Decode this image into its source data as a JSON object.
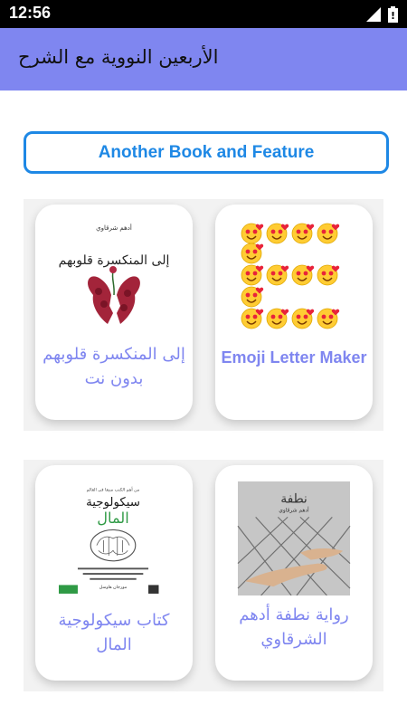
{
  "status_bar": {
    "time": "12:56"
  },
  "app_bar": {
    "title": "الأربعين النووية مع الشرح"
  },
  "feature_button": {
    "label": "Another Book and Feature"
  },
  "colors": {
    "app_bar": "#7f86f0",
    "accent_blue": "#1e88e5",
    "card_title": "#7f86f0"
  },
  "cards": [
    {
      "title": "Emoji Letter Maker",
      "icon": "emoji-letter-e-image"
    },
    {
      "title": "إلى المنكسرة قلوبهم بدون نت",
      "icon": "book-cover-broken-hearts"
    },
    {
      "title": "رواية نطفة أدهم الشرقاوي",
      "icon": "book-cover-nutfa"
    },
    {
      "title": "كتاب سيكولوجية المال",
      "icon": "book-cover-psychology-of-money"
    }
  ],
  "book_covers": {
    "broken_hearts": {
      "author": "أدهم شرقاوي",
      "title": "إلى المنكسرة قلوبهم"
    },
    "nutfa": {
      "title": "نطفة",
      "author": "أدهم شرقاوي"
    },
    "money": {
      "top": "من أهم الكتب مبيعا في العالم",
      "title1": "سيكولوجية",
      "title2": "المال",
      "author": "مورجان هاوسل"
    }
  }
}
